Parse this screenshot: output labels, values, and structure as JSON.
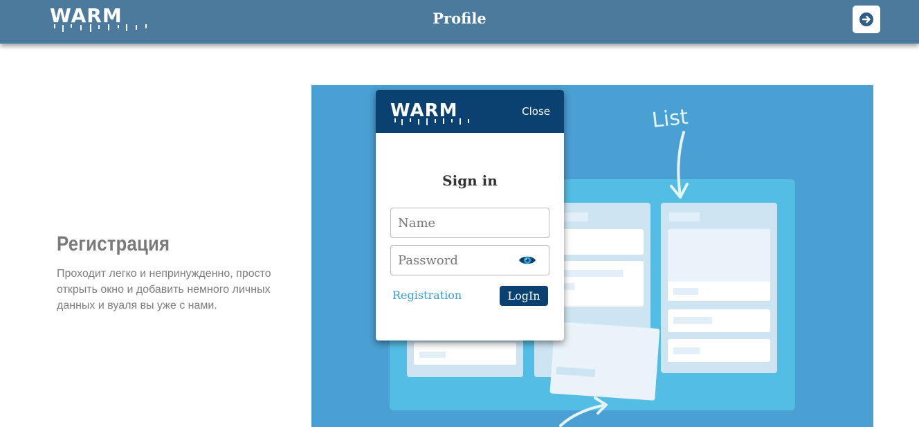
{
  "header": {
    "logo_text": "WARM",
    "title": "Profile",
    "logout_icon": "arrow-right-circle-icon"
  },
  "intro": {
    "heading": "Регистрация",
    "text": "Проходит легко и непринужденно, просто открыть окно и добавить немного личных данных и вуаля вы уже с нами."
  },
  "illustration": {
    "annotation": "List"
  },
  "modal": {
    "logo_text": "WARM",
    "close_label": "Close",
    "title": "Sign in",
    "name_placeholder": "Name",
    "password_placeholder": "Password",
    "eye_icon": "eye-icon",
    "registration_label": "Registration",
    "login_label": "LogIn"
  },
  "colors": {
    "header_bg": "#4b7a9c",
    "modal_header_bg": "#0a4170",
    "illustration_bg": "#4a9fd3",
    "link": "#3a9fd0"
  }
}
